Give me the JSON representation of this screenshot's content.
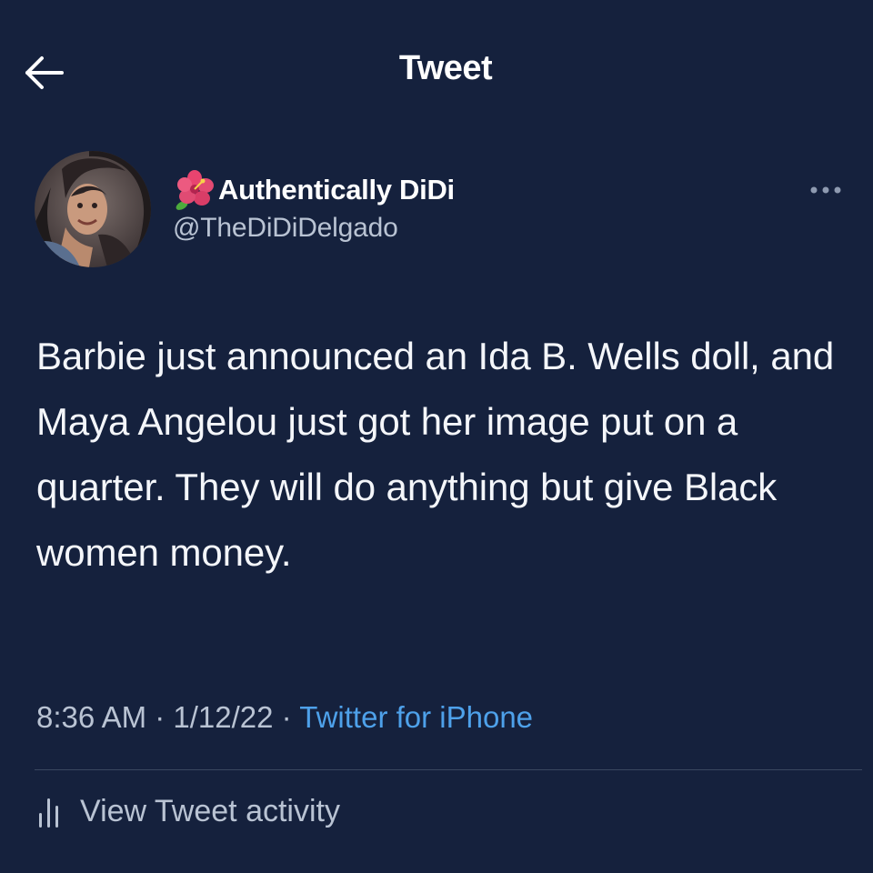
{
  "header": {
    "title": "Tweet",
    "back_icon": "arrow-left-icon"
  },
  "author": {
    "display_name": "Authentically DiDi",
    "name_emoji": "hibiscus-icon",
    "handle": "@TheDiDiDelgado",
    "more_icon": "more-dots-icon"
  },
  "tweet": {
    "text": "Barbie just announced an Ida B. Wells doll, and Maya Angelou just got her image put on a quarter. They will do anything but give Black women money."
  },
  "meta": {
    "time": "8:36 AM",
    "sep1": " · ",
    "date": "1/12/22",
    "sep2": " · ",
    "source": "Twitter for iPhone"
  },
  "footer": {
    "activity_label": "View Tweet activity",
    "activity_icon": "bar-chart-icon"
  },
  "colors": {
    "background": "#15213d",
    "text": "#ffffff",
    "secondary": "#b9c3d3",
    "link": "#4ea1ea",
    "divider": "#3a4760"
  }
}
